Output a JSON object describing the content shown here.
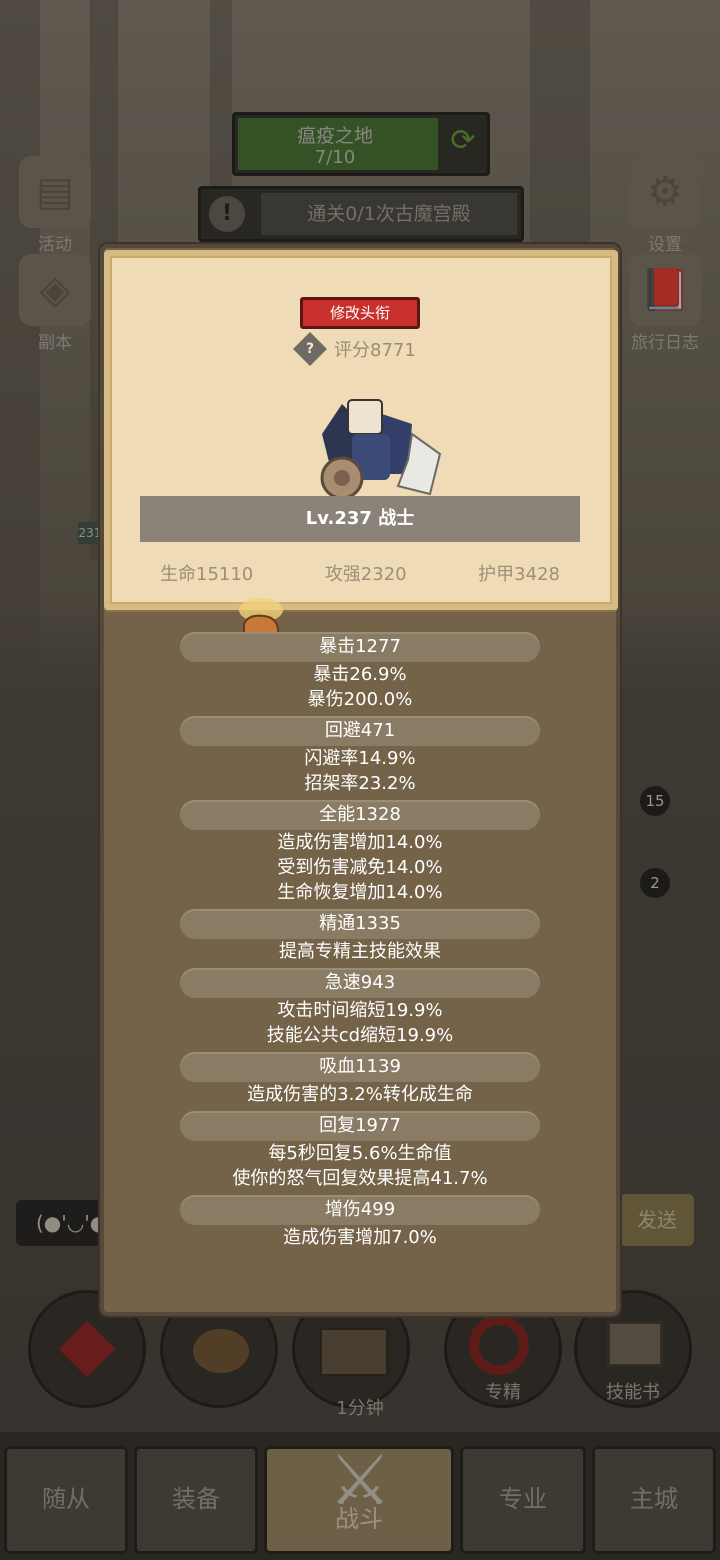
{
  "map": {
    "name": "瘟疫之地",
    "progress": "7/10"
  },
  "quest": {
    "text": "通关0/1次古魔宫殿"
  },
  "side_left": [
    {
      "label": "活动",
      "icon": "activity-book-icon"
    },
    {
      "label": "副本",
      "icon": "dungeon-portal-icon"
    }
  ],
  "side_right": [
    {
      "label": "设置",
      "icon": "gear-icon"
    },
    {
      "label": "旅行日志",
      "icon": "journal-icon"
    }
  ],
  "side_badge": "231",
  "profile": {
    "edit_title_button": "修改头衔",
    "score": "评分8771",
    "level_class": "Lv.237 战士",
    "hp": "生命15110",
    "attack": "攻强2320",
    "armor": "护甲3428"
  },
  "stats": [
    {
      "header": "暴击1277",
      "lines": [
        "暴击26.9%",
        "暴伤200.0%"
      ]
    },
    {
      "header": "回避471",
      "lines": [
        "闪避率14.9%",
        "招架率23.2%"
      ]
    },
    {
      "header": "全能1328",
      "lines": [
        "造成伤害增加14.0%",
        "受到伤害减免14.0%",
        "生命恢复增加14.0%"
      ]
    },
    {
      "header": "精通1335",
      "lines": [
        "提高专精主技能效果"
      ]
    },
    {
      "header": "急速943",
      "lines": [
        "攻击时间缩短19.9%",
        "技能公共cd缩短19.9%"
      ]
    },
    {
      "header": "吸血1139",
      "lines": [
        "造成伤害的3.2%转化成生命"
      ]
    },
    {
      "header": "回复1977",
      "lines": [
        "每5秒回复5.6%生命值",
        "使你的怒气回复效果提高41.7%"
      ]
    },
    {
      "header": "增伤499",
      "lines": [
        "造成伤害增加7.0%"
      ]
    }
  ],
  "item_badges": [
    "15",
    "2"
  ],
  "chat": {
    "emote": "(●'◡'●",
    "send": "发送"
  },
  "round_buttons": {
    "chest_timer": "1分钟",
    "specialization": "专精",
    "skill_book": "技能书"
  },
  "nav": [
    "随从",
    "装备",
    "战斗",
    "专业",
    "主城"
  ],
  "colors": {
    "title_button": "#c7302c",
    "parchment": "#efdcb6",
    "card": "#746349"
  }
}
